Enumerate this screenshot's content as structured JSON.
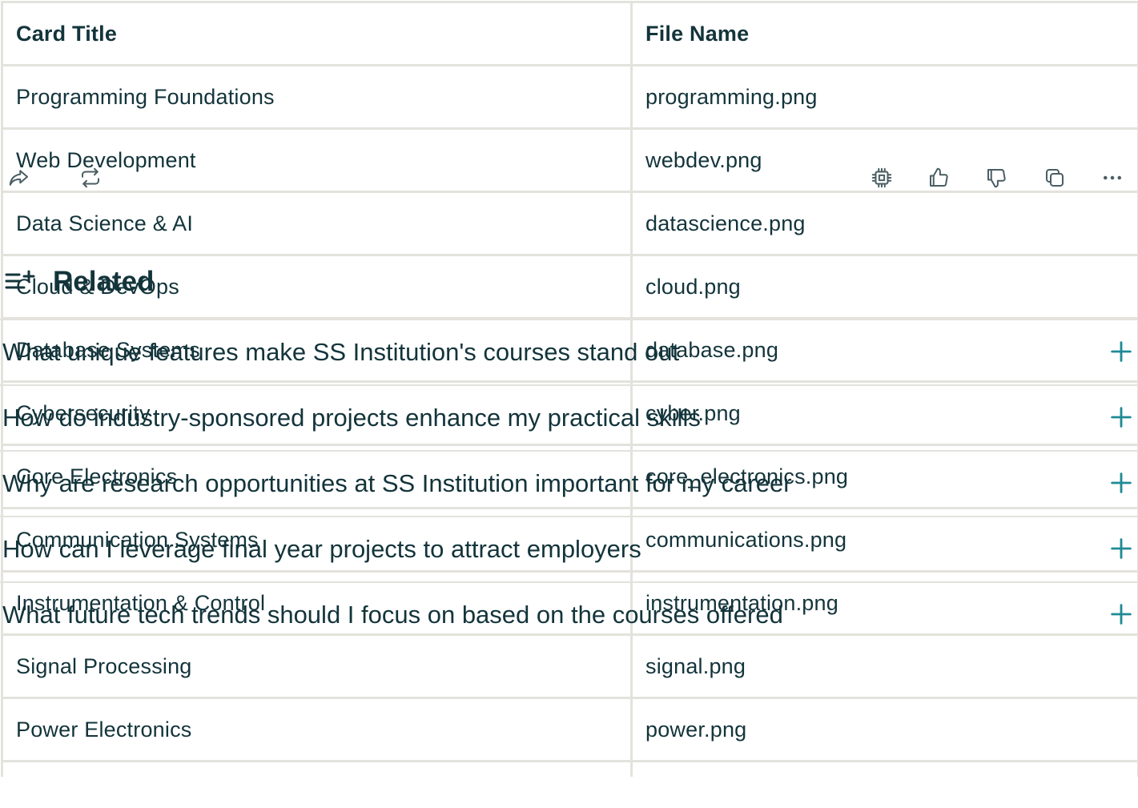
{
  "table": {
    "headers": [
      "Card Title",
      "File Name"
    ],
    "rows": [
      [
        "Programming Foundations",
        "programming.png"
      ],
      [
        "Web Development",
        "webdev.png"
      ],
      [
        "Data Science & AI",
        "datascience.png"
      ],
      [
        "Cloud & DevOps",
        "cloud.png"
      ],
      [
        "Database Systems",
        "database.png"
      ],
      [
        "Cybersecurity",
        "cyber.png"
      ],
      [
        "Core Electronics",
        "core_electronics.png"
      ],
      [
        "Communication Systems",
        "communications.png"
      ],
      [
        "Instrumentation & Control",
        "instrumentation.png"
      ],
      [
        "Signal Processing",
        "signal.png"
      ],
      [
        "Power Electronics",
        "power.png"
      ]
    ]
  },
  "actions": {
    "left_icons": [
      "share-icon",
      "rewrite-icon"
    ],
    "right_icons": [
      "model-chip-icon",
      "thumbs-up-icon",
      "thumbs-down-icon",
      "copy-icon",
      "more-icon"
    ]
  },
  "related": {
    "title": "Related",
    "questions": [
      "What unique features make SS Institution's courses stand out",
      "How do industry-sponsored projects enhance my practical skills",
      "Why are research opportunities at SS Institution important for my career",
      "How can I leverage final year projects to attract employers",
      "What future tech trends should I focus on based on the courses offered"
    ]
  },
  "colors": {
    "text": "#13343b",
    "border": "#e3e2dc",
    "accent": "#1f8a96",
    "icon": "#4a5e63"
  }
}
